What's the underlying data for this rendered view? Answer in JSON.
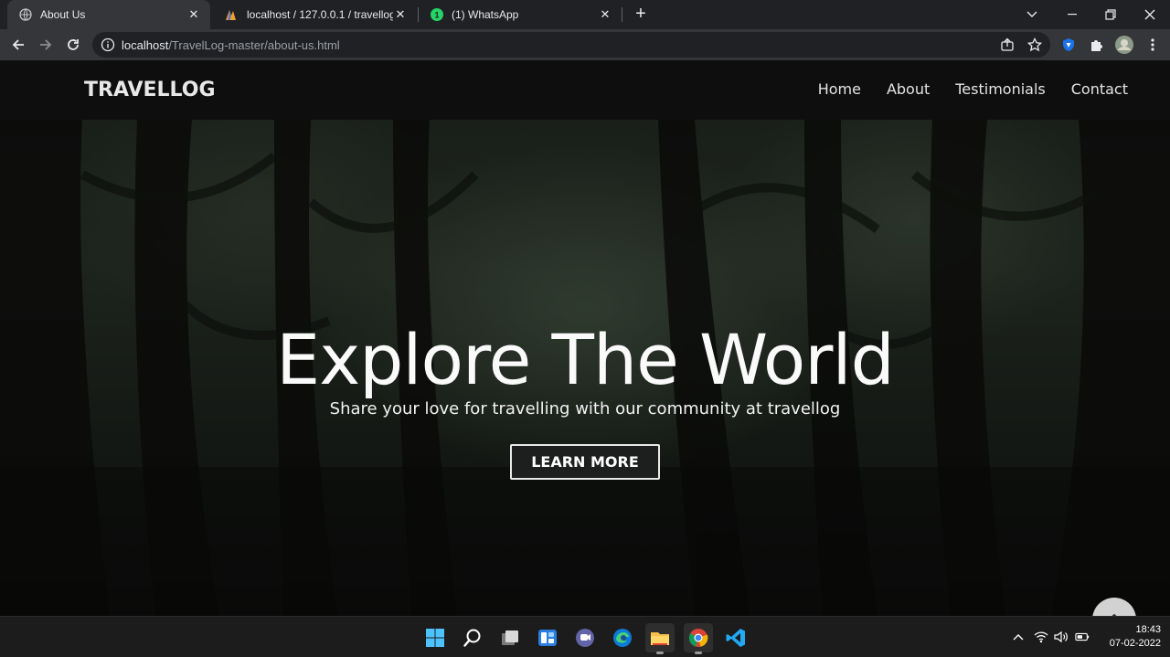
{
  "browser": {
    "tabs": [
      {
        "title": "About Us",
        "icon": "globe-icon",
        "active": true
      },
      {
        "title": "localhost / 127.0.0.1 / travellog | ",
        "icon": "phpmyadmin-icon",
        "active": false
      },
      {
        "title": "(1) WhatsApp",
        "icon": "whatsapp-icon",
        "active": false
      }
    ],
    "url_host": "localhost",
    "url_path": "/TravelLog-master/about-us.html"
  },
  "site": {
    "brand": "TRAVELLOG",
    "nav": [
      "Home",
      "About",
      "Testimonials",
      "Contact"
    ],
    "hero_title": "Explore The World",
    "hero_subtitle": "Share your love for travelling with our community at travellog",
    "hero_button": "LEARN MORE"
  },
  "taskbar": {
    "time": "18:43",
    "date": "07-02-2022"
  },
  "colors": {
    "chrome_dark": "#202124",
    "chrome_tab": "#35363a",
    "nav_bg": "#0e0e0e",
    "whatsapp_green": "#25d366",
    "shield_blue": "#1a73e8"
  }
}
